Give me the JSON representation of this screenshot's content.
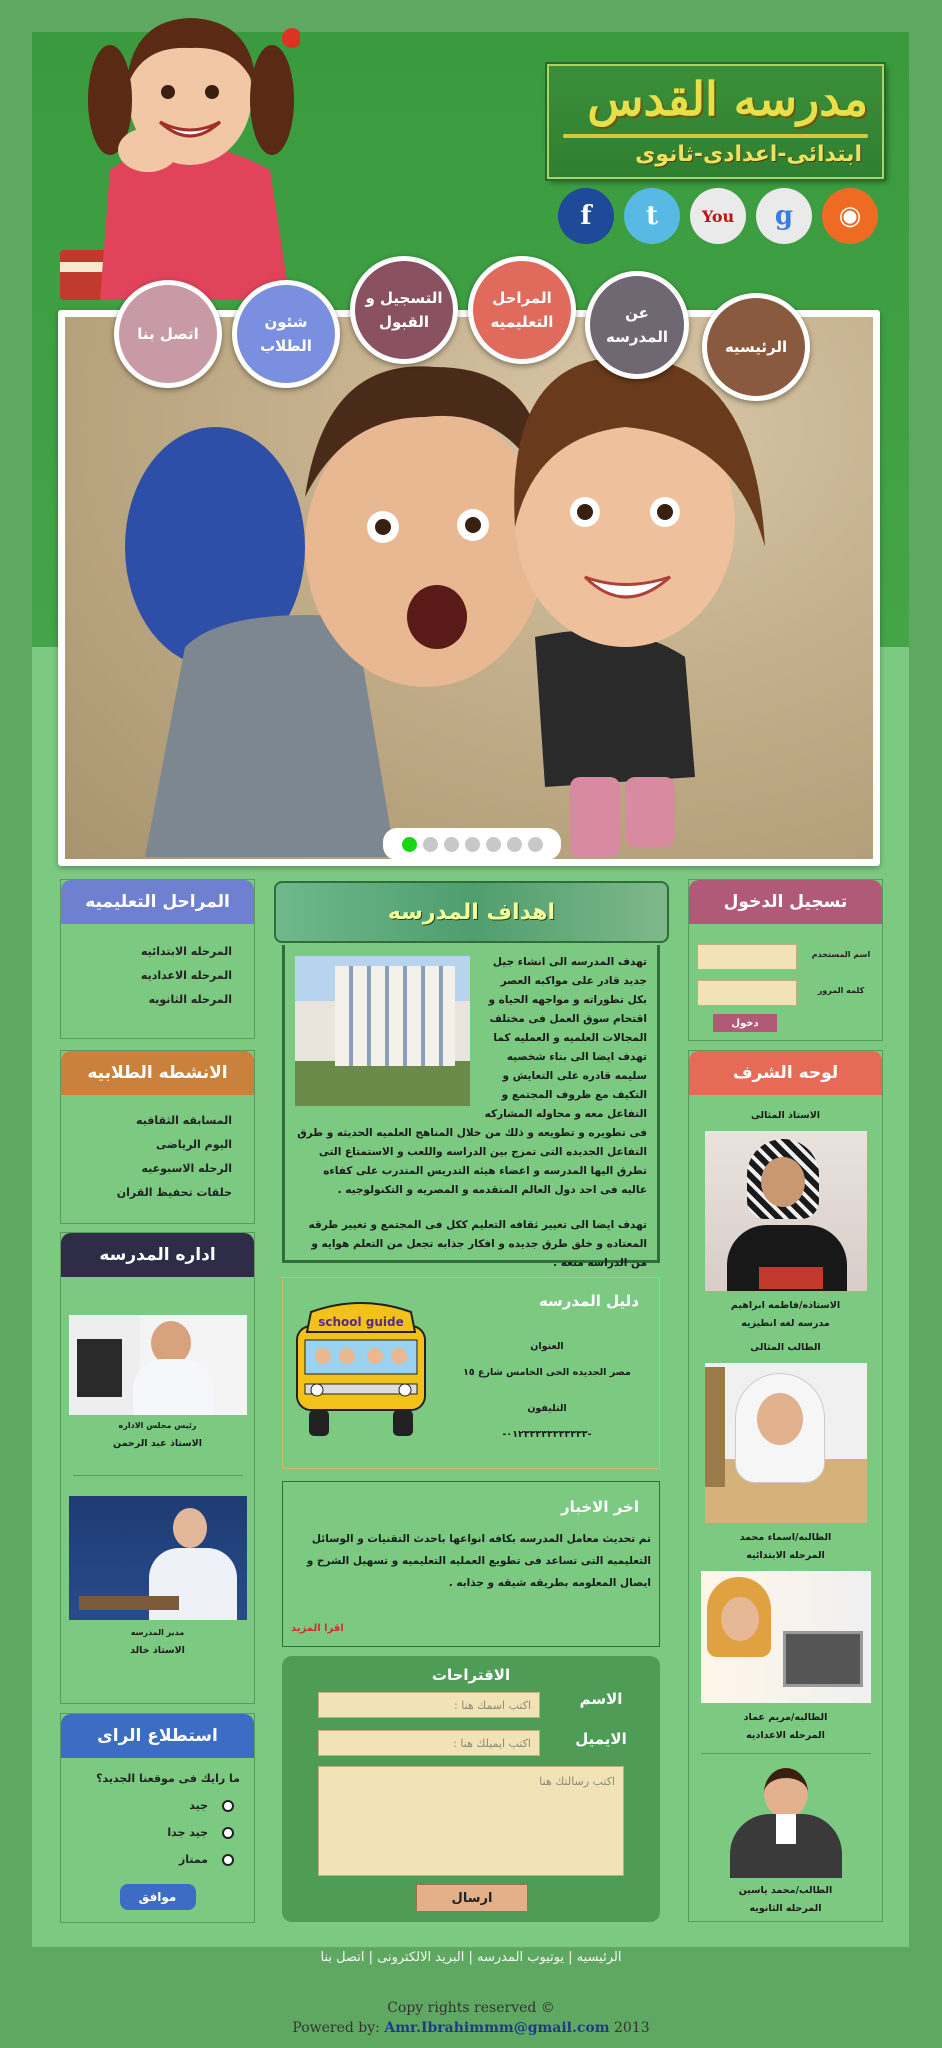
{
  "header": {
    "school_name": "مدرسه القدس",
    "school_levels": "ابتدائى-اعدادى-ثانوى"
  },
  "social": [
    {
      "icon": "rss-icon",
      "color": "#ef6a22",
      "glyph": "⊚"
    },
    {
      "icon": "google-icon",
      "color": "#e8e8e8",
      "glyph": "g"
    },
    {
      "icon": "youtube-icon",
      "color": "#e8e8e8",
      "glyph": "▶"
    },
    {
      "icon": "twitter-icon",
      "color": "#57b9e4",
      "glyph": "t"
    },
    {
      "icon": "facebook-icon",
      "color": "#1f4a9a",
      "glyph": "f"
    }
  ],
  "nav": {
    "home": "الرئيسيه",
    "about": "عن المدرسه",
    "stages": "المراحل التعليميه",
    "register": "التسجيل و القبول",
    "students": "شئون الطلاب",
    "contact": "اتصل بنا"
  },
  "slider": {
    "dots_total": 7,
    "active_dot": 1
  },
  "login": {
    "title": "تسجيل الدخول",
    "username_label": "اسم المستخدم",
    "password_label": "كلمه المرور",
    "button": "دخول"
  },
  "honor": {
    "title": "لوحه الشرف",
    "ideal_teacher_label": "الاستاذ المثالى",
    "teacher_caption1": "الاستاذه/فاطمه ابراهيم",
    "teacher_caption2": "مدرسه لغه انطيزيه",
    "ideal_student_label": "الطالب المثالى",
    "s1_caption1": "الطالبه/اسماء محمد",
    "s1_caption2": "المرحله الابتدائيه",
    "s2_caption1": "الطالبه/مريم عماد",
    "s2_caption2": "المرحله الاعداديه",
    "s3_caption1": "الطالب/محمد ياسين",
    "s3_caption2": "المرحله الثانويه"
  },
  "stages": {
    "title": "المراحل التعليميه",
    "items": [
      "المرحله الابتدائيه",
      "المرحله الاعداديه",
      "المرحله الثانويه"
    ]
  },
  "activities": {
    "title": "الانشطه الطلابيه",
    "items": [
      "المسابقه الثقافيه",
      "اليوم الرياضى",
      "الرحله الاسبوعيه",
      "حلقات تحفيظ القران"
    ]
  },
  "admin": {
    "title": "اداره المدرسه",
    "p1_role": "رئيس مجلس الاداره",
    "p1_name": "الاستاذ عبد الرحمن",
    "p2_role": "مدير المدرسه",
    "p2_name": "الاستاذ خالد"
  },
  "poll": {
    "title": "استطلاع الراى",
    "question": "ما رايك فى موقعنا الجديد؟",
    "options": [
      "جيد",
      "جيد جدا",
      "ممتاز"
    ],
    "button": "موافق"
  },
  "goals": {
    "title": "اهداف المدرسه",
    "para1": "تهدف المدرسه الى انشاء جيل جديد قادر على مواكبه العصر بكل تطوراته و مواجهه الحياه و اقتحام سوق العمل فى مختلف المجالات العلميه و العمليه كما تهدف ايضا الى بناء شخصيه سليمه قادره على التعايش و التكيف مع ظروف المجتمع و التفاعل معه و محاوله المشاركه فى تطويره و تطويعه و ذلك من خلال المناهج العلميه الحديثه و طرق التفاعل الجديده التى تمزج بين الدراسه واللعب و الاستمتاع التى تطرق اليها المدرسه و اعضاء هيئه التدريس المتدرب على كفاءه عاليه فى احد دول العالم المتقدمه و المصريه و التكنولوجيه .",
    "para2": "تهدف ايضا الى تغيير ثقافه التعليم ككل فى المجتمع و تغيير طرقه المعتاده و خلق طرق جديده و افكار جذابه تجعل من التعلم هوايه و من الدراسه متعه ."
  },
  "guide": {
    "title": "دليل المدرسه",
    "bus_sign": "school guide",
    "address_label": "العنوان",
    "address": "مصر الجديده الحى الخامس شارع ١٥",
    "phone_label": "التليفون",
    "phone": "-٠١٢٣٣٣٣٣٣٣٣٣٣٣-"
  },
  "news": {
    "title": "اخر الاخبار",
    "body": "تم تحديث معامل المدرسه بكافه انواعها باحدث التقنيات و الوسائل التعليميه التى تساعد فى تطويع العمليه التعليميه و تسهيل الشرح و ايصال المعلومه بطريقه شيقه و جذابه .",
    "more": "اقرا المزيد"
  },
  "suggestions": {
    "title": "الاقتراحات",
    "name_label": "الاسم",
    "name_placeholder": "اكتب اسمك هنا :",
    "email_label": "الايميل",
    "email_placeholder": "اكتب ايميلك هنا :",
    "message_placeholder": "اكتب رسالتك هنا",
    "send": "ارسال"
  },
  "footer": {
    "links": "الرئيسيه | يوتيوب المدرسه | البريد الالكترونى | اتصل بنا",
    "copyright": "Copy rights reserved ©",
    "powered_prefix": "Powered by:",
    "email": "Amr.Ibrahimmm@gmail.com",
    "year": "2013"
  }
}
